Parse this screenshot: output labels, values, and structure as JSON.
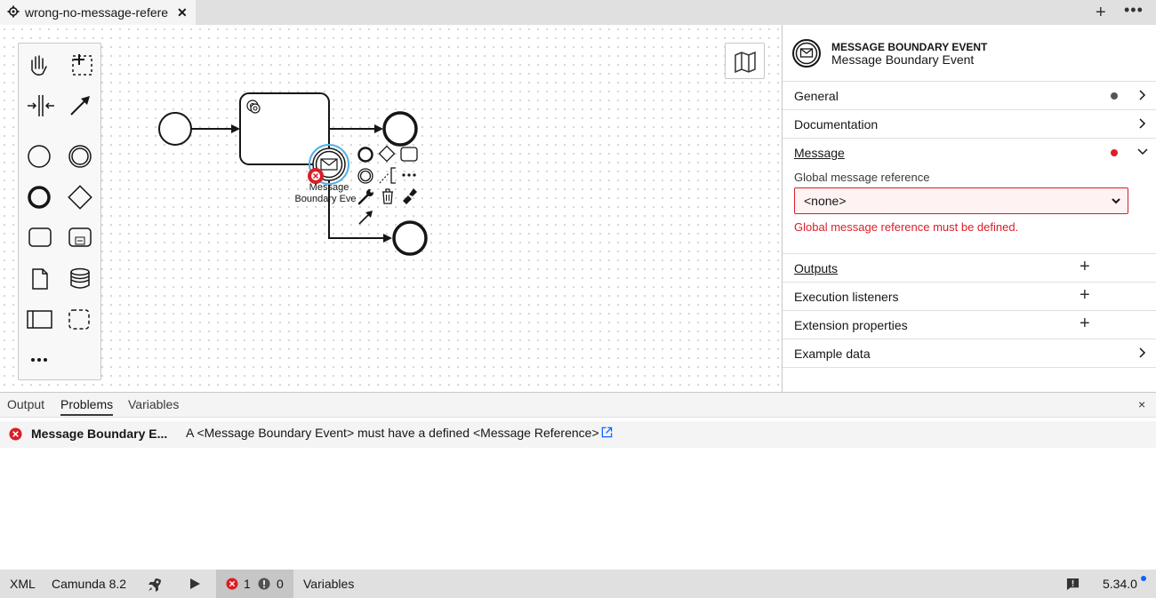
{
  "tab": {
    "title": "wrong-no-message-refere",
    "close_icon": "close-icon",
    "file_icon": "gear-icon"
  },
  "tabbar": {
    "new_tab_label": "+",
    "more_label": "•••"
  },
  "canvas": {
    "element_label_line1": "Message",
    "element_label_line2": "Boundary Eve"
  },
  "properties": {
    "element_type": "MESSAGE BOUNDARY EVENT",
    "element_name": "Message Boundary Event",
    "groups": {
      "general": "General",
      "documentation": "Documentation",
      "message": "Message",
      "outputs": "Outputs",
      "execution_listeners": "Execution listeners",
      "extension_properties": "Extension properties",
      "example_data": "Example data"
    },
    "message_ref_label": "Global message reference",
    "message_ref_value": "<none>",
    "message_ref_error": "Global message reference must be defined."
  },
  "bottom_panel": {
    "tabs": [
      "Output",
      "Problems",
      "Variables"
    ],
    "active_tab": "Problems",
    "close_label": "×",
    "problems": [
      {
        "element": "Message Boundary E...",
        "message": "A <Message Boundary Event> must have a defined <Message Reference>"
      }
    ]
  },
  "statusbar": {
    "xml": "XML",
    "engine": "Camunda 8.2",
    "errors": "1",
    "warnings": "0",
    "variables": "Variables",
    "version": "5.34.0"
  },
  "colors": {
    "error": "#da1e28",
    "selection": "#0f62fe"
  }
}
